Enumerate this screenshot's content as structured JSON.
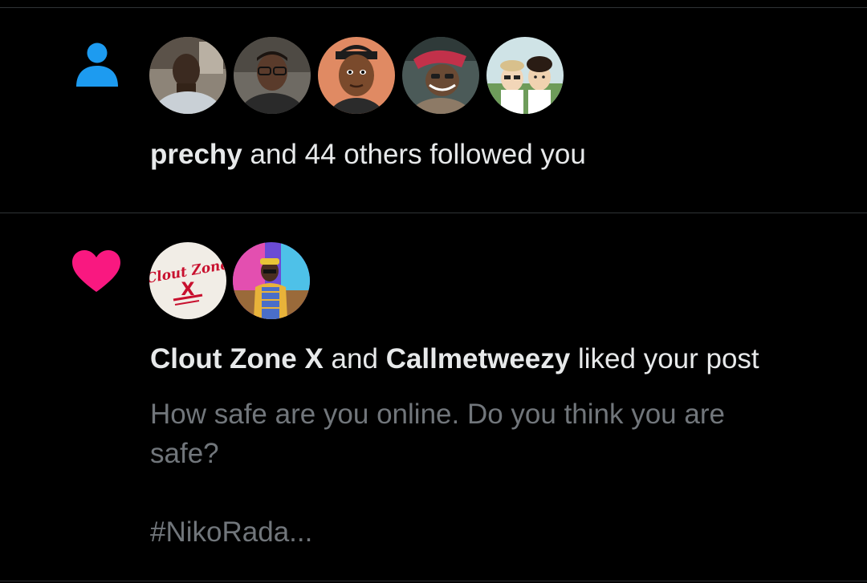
{
  "notifications": [
    {
      "type": "follow",
      "icon": "person-icon",
      "icon_color": "#1d9bf0",
      "avatars": [
        "avatar-1",
        "avatar-2",
        "avatar-3",
        "avatar-4",
        "avatar-5"
      ],
      "actor": "prechy",
      "text": "and 44 others followed you"
    },
    {
      "type": "like",
      "icon": "heart-icon",
      "icon_color": "#f91880",
      "avatars": [
        "avatar-clout-zone-x",
        "avatar-callmetweezy"
      ],
      "avatar_logo": {
        "line1": "Clout Zone",
        "line2": "X"
      },
      "actor1": "Clout Zone X",
      "connector": "and",
      "actor2": "Callmetweezy",
      "text": "liked your post",
      "post_snippet_line1": "How safe are you online. Do you think you are",
      "post_snippet_line2": "safe?",
      "post_hashtag": "#NikoRada..."
    }
  ],
  "colors": {
    "background": "#000000",
    "divider": "#2f3336",
    "primary_text": "#e7e9ea",
    "secondary_text": "#71767b"
  }
}
